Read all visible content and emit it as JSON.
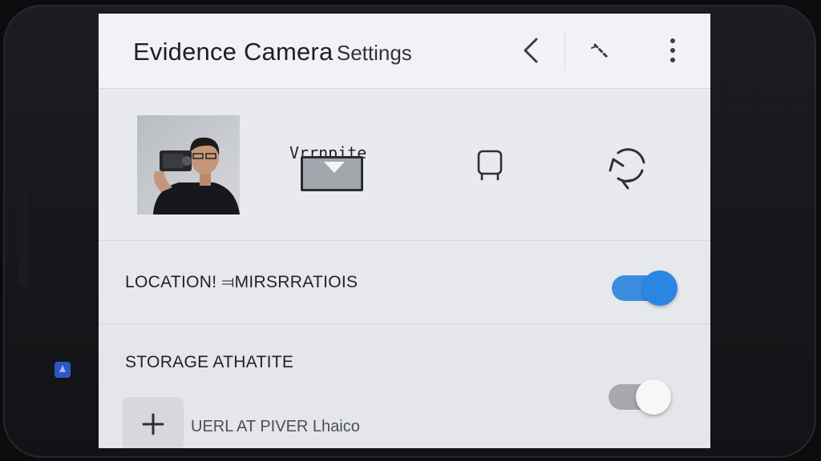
{
  "header": {
    "title_main": "Evidence Camera",
    "title_sub": "Settings",
    "icons": [
      "back-chevron-icon",
      "wand-icon",
      "overflow-menu-icon"
    ]
  },
  "media_row": {
    "label": "Vrrnpite",
    "icons": [
      "video-frame-icon",
      "crop-icon",
      "rotate-icon"
    ]
  },
  "location_row": {
    "label": "LOCATION! ⫤MIRSRRATIOIS",
    "toggle_on": true
  },
  "storage_row": {
    "label": "STORAGE ATHATITE",
    "toggle_on": false,
    "add_icon": "plus-icon",
    "add_text": "UERL AT PIVER Lhaico"
  },
  "colors": {
    "accent": "#2a86e3",
    "screen_bg": "#e9ebef",
    "text": "#1f2126"
  }
}
